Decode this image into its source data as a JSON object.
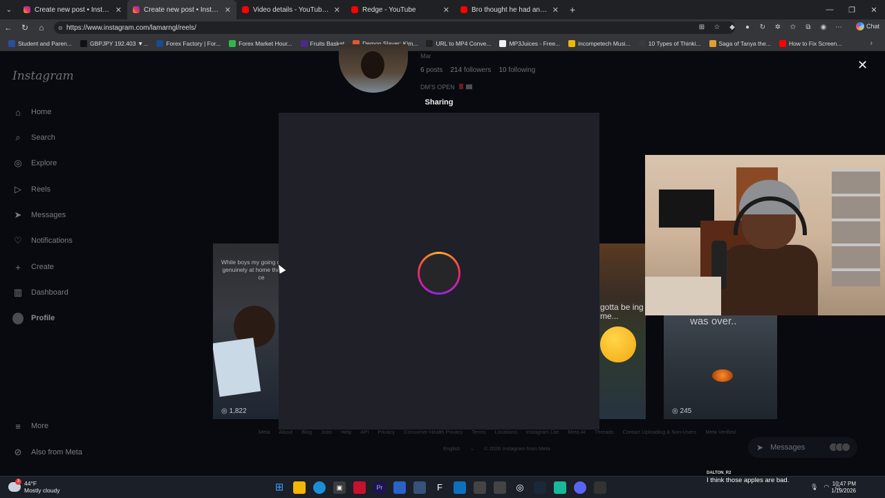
{
  "browser": {
    "tabs": [
      {
        "title": "Create new post • Instagram",
        "favicon": "instagram",
        "active": false
      },
      {
        "title": "Create new post • Instagram",
        "favicon": "instagram",
        "active": true
      },
      {
        "title": "Video details - YouTube Studio",
        "favicon": "youtube",
        "active": false
      },
      {
        "title": "Redge - YouTube",
        "favicon": "youtube",
        "active": false
      },
      {
        "title": "Bro thought he had an easy lick..🍊",
        "favicon": "youtube",
        "active": false
      }
    ],
    "new_tab_label": "+",
    "url": "https://www.instagram.com/lamarngl/reels/",
    "copilot_label": "Chat",
    "bookmarks": [
      {
        "label": "Student and Paren...",
        "color": "#2b4ea2"
      },
      {
        "label": "GBPJPY 192.403 ▼...",
        "color": "#111111"
      },
      {
        "label": "Forex Factory | For...",
        "color": "#1c4a8c"
      },
      {
        "label": "Forex Market Hour...",
        "color": "#2fb84a"
      },
      {
        "label": "Fruits Basket",
        "color": "#4b2a8a"
      },
      {
        "label": "Demon Slayer: Kim...",
        "color": "#e4572e"
      },
      {
        "label": "URL to MP4 Conve...",
        "color": "#222222"
      },
      {
        "label": "MP3Juices - Free...",
        "color": "#f2f2f2"
      },
      {
        "label": "incompetech Musi...",
        "color": "#f2b705"
      },
      {
        "label": "10 Types of Thinki...",
        "color": "#3a3a3a"
      },
      {
        "label": "Saga of Tanya the...",
        "color": "#e0a030"
      },
      {
        "label": "How to Fix Screen...",
        "color": "#ff0000"
      }
    ]
  },
  "sidebar": {
    "logo": "Instagram",
    "items": [
      {
        "label": "Home",
        "icon": "home-icon"
      },
      {
        "label": "Search",
        "icon": "search-icon"
      },
      {
        "label": "Explore",
        "icon": "compass-icon"
      },
      {
        "label": "Reels",
        "icon": "reels-icon"
      },
      {
        "label": "Messages",
        "icon": "messenger-icon"
      },
      {
        "label": "Notifications",
        "icon": "heart-icon"
      },
      {
        "label": "Create",
        "icon": "plus-icon"
      },
      {
        "label": "Dashboard",
        "icon": "dashboard-icon"
      },
      {
        "label": "Profile",
        "icon": "avatar"
      }
    ],
    "more": "More",
    "meta": "Also from Meta"
  },
  "profile": {
    "name_fragment": "Mar",
    "posts": "6",
    "posts_label": "posts",
    "followers": "214",
    "followers_label": "followers",
    "following": "10",
    "following_label": "following",
    "bio": "DM'S OPEN"
  },
  "reels": {
    "left_caption": "While boys my going out and p genuinely at home thank u kai ce",
    "left_views": "1,822",
    "right_caption": "gotta be ing me...",
    "far_right_caption": "was over..",
    "far_right_views": "245"
  },
  "modal": {
    "title": "Sharing",
    "state": "loading"
  },
  "footer": {
    "links": [
      "Meta",
      "About",
      "Blog",
      "Jobs",
      "Help",
      "API",
      "Privacy",
      "Consumer Health Privacy",
      "Terms",
      "Locations",
      "Instagram Lite",
      "Meta AI",
      "Threads",
      "Contact Uploading & Non-Users",
      "Meta Verified"
    ],
    "language": "English",
    "copyright": "© 2026 Instagram from Meta"
  },
  "messages_pill": {
    "label": "Messages"
  },
  "taskbar": {
    "weather_temp": "44°F",
    "weather_desc": "Mostly cloudy",
    "weather_badge": "3",
    "time": "10:47 PM",
    "date": "1/19/2026"
  },
  "notification": {
    "from": "DALTON_R2",
    "message": "I think those apples are bad."
  }
}
